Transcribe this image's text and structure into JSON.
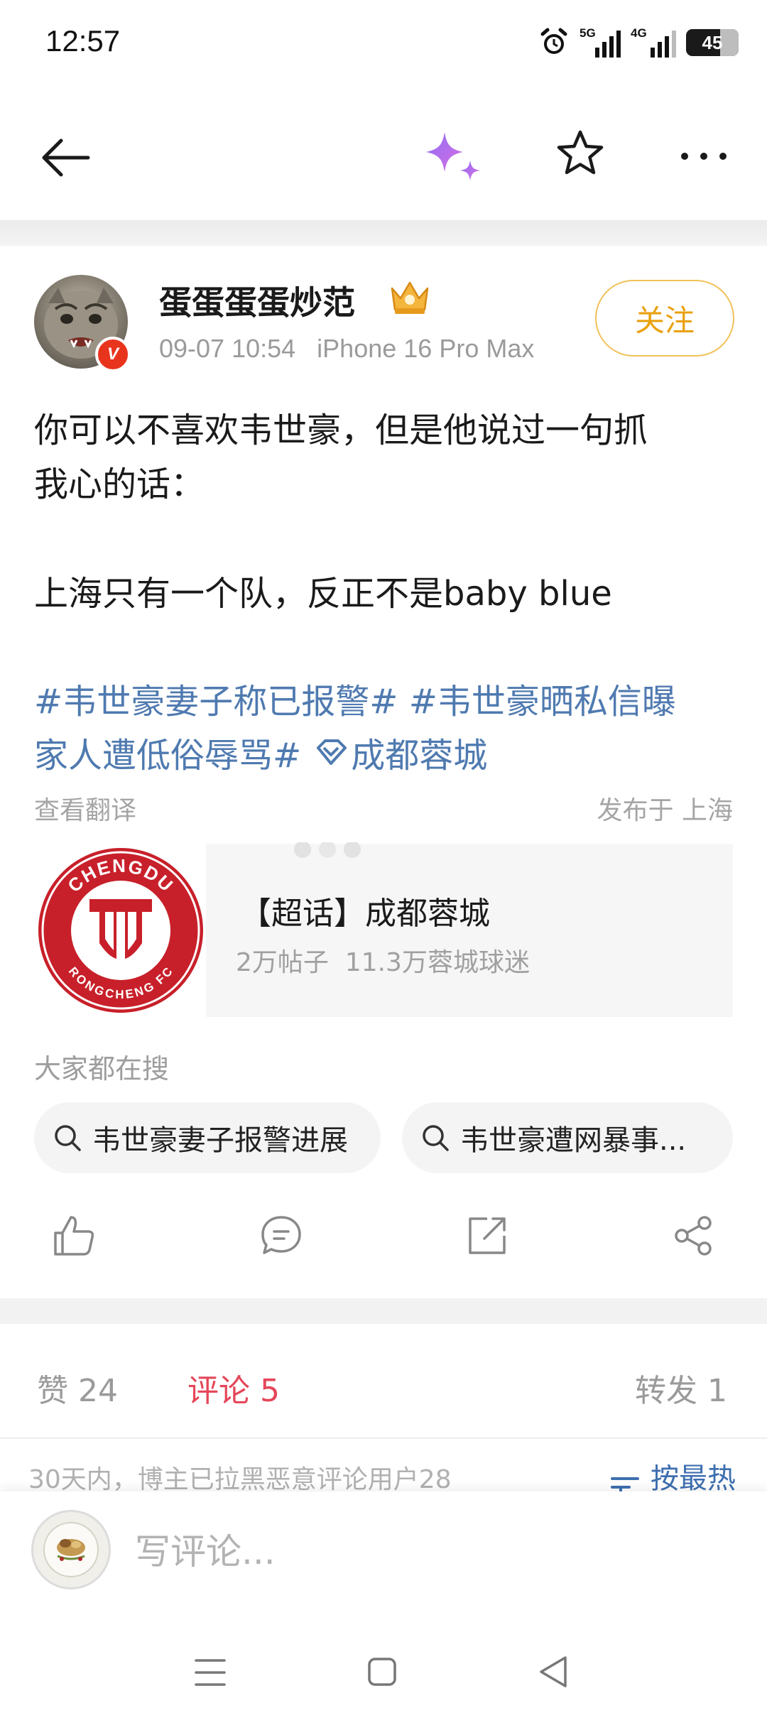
{
  "status_bar": {
    "time": "12:57",
    "signal1_label": "5G",
    "signal2_label": "4G",
    "battery": "45",
    "icons": [
      "alarm-icon",
      "signal-5g-icon",
      "signal-4g-icon",
      "battery-icon"
    ]
  },
  "top_nav": {
    "icons": [
      "back-arrow-icon",
      "ai-sparkle-icon",
      "star-icon",
      "more-icon"
    ]
  },
  "post": {
    "username": "蛋蛋蛋蛋炒范",
    "meta": "09-07 10:54   iPhone 16 Pro Max",
    "follow_label": "关注",
    "body_lines": [
      "你可以不喜欢韦世豪，但是他说过一句抓",
      "我心的话：",
      "上海只有一个队，反正不是baby blue"
    ],
    "tags_line1": "#韦世豪妻子称已报警# #韦世豪晒私信曝",
    "tags_line2": "家人遭低俗辱骂#",
    "super_topic_link": "成都蓉城",
    "translate_label": "查看翻译",
    "publish_location": "发布于 上海"
  },
  "topic_card": {
    "title": "【超话】成都蓉城",
    "stats": "2万帖子  11.3万蓉城球迷",
    "logo_text_top": "CHENGDU",
    "logo_text_bottom": "RONGCHENG FC"
  },
  "search": {
    "heading": "大家都在搜",
    "chips": [
      "韦世豪妻子报警进展",
      "韦世豪遭网暴事..."
    ]
  },
  "actions": [
    "like-icon",
    "comment-icon",
    "repost-icon",
    "share-icon"
  ],
  "stats": {
    "like_label": "赞 24",
    "comment_label": "评论 5",
    "repost_label": "转发 1"
  },
  "notice": "30天内，博主已拉黑恶意评论用户28",
  "sort_label": "按最热",
  "comment_bar": {
    "placeholder": "写评论..."
  },
  "colors": {
    "accent_orange": "#e9a10f",
    "link_blue": "#4f7ab0",
    "comment_red": "#e4475a",
    "verified_red": "#e8341c",
    "club_red": "#c8202a"
  }
}
